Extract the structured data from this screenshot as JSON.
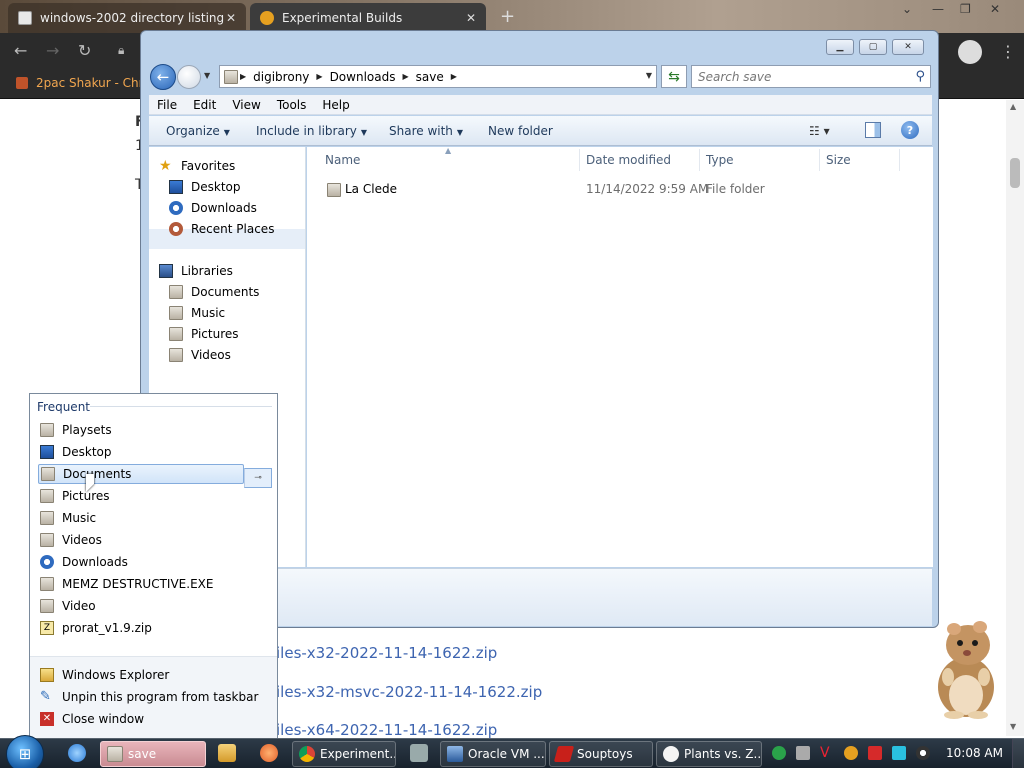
{
  "browser": {
    "tabs": [
      {
        "title": "windows-2002 directory listing",
        "color": "#e8e8e8"
      },
      {
        "title": "Experimental Builds",
        "color": "#e6a020"
      }
    ],
    "new_tab": "+",
    "bookmark": "2pac Shakur - Chro",
    "page_text_letter": "F",
    "page_text_digit": "1",
    "page_text_t": "T",
    "links": [
      "iles-x32-2022-11-14-1622.zip",
      "iles-x32-msvc-2022-11-14-1622.zip",
      "iles-x64-2022-11-14-1622.zip"
    ]
  },
  "explorer": {
    "breadcrumb": [
      "digibrony",
      "Downloads",
      "save"
    ],
    "search_placeholder": "Search save",
    "menu": [
      "File",
      "Edit",
      "View",
      "Tools",
      "Help"
    ],
    "commands": {
      "organize": "Organize",
      "include": "Include in library",
      "share": "Share with",
      "new_folder": "New folder"
    },
    "nav": {
      "favorites": "Favorites",
      "favorites_items": [
        "Desktop",
        "Downloads",
        "Recent Places"
      ],
      "libraries": "Libraries",
      "libraries_items": [
        "Documents",
        "Music",
        "Pictures",
        "Videos"
      ]
    },
    "columns": {
      "name": "Name",
      "date": "Date modified",
      "type": "Type",
      "size": "Size"
    },
    "files": [
      {
        "name": "La Clede",
        "date": "11/14/2022 9:59 AM",
        "type": "File folder",
        "size": ""
      }
    ]
  },
  "jumplist": {
    "frequent_header": "Frequent",
    "frequent": [
      "Playsets",
      "Desktop",
      "Documents",
      "Pictures",
      "Music",
      "Videos",
      "Downloads",
      "MEMZ DESTRUCTIVE.EXE",
      "Video",
      "prorat_v1.9.zip"
    ],
    "tasks": [
      "Windows Explorer",
      "Unpin this program from taskbar",
      "Close window"
    ]
  },
  "taskbar": {
    "buttons": [
      "save",
      "Experiment...",
      "Oracle VM ...",
      "Souptoys",
      "Plants vs. Z..."
    ],
    "clock": "10:08 AM"
  },
  "colors": {
    "accent_blue": "#2a66b8",
    "link_blue": "#3d64b0",
    "bookmark_orange": "#f1a64f",
    "active_task": "#c98b92"
  }
}
